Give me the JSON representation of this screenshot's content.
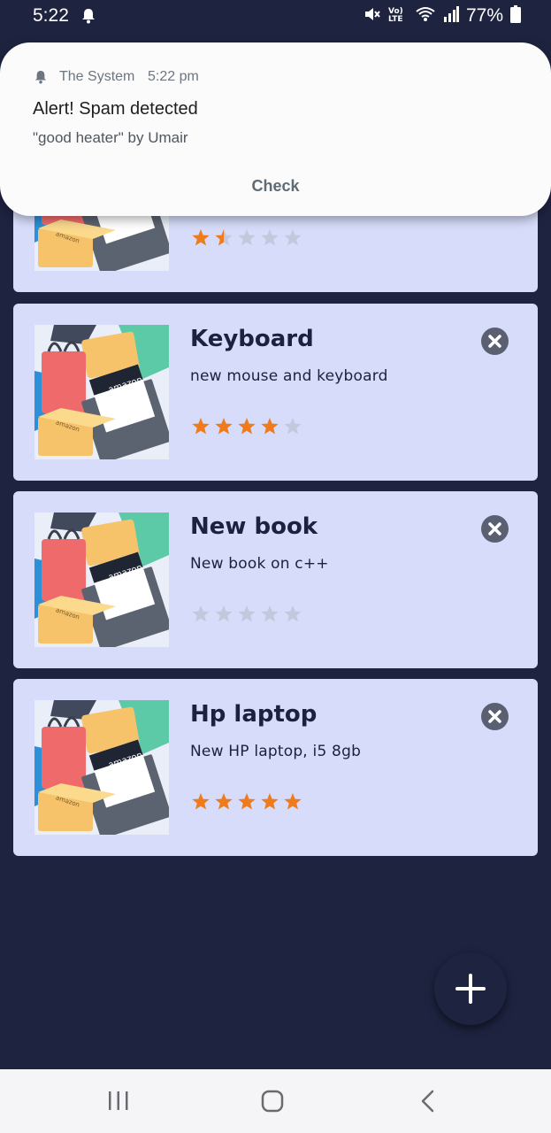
{
  "status_bar": {
    "time": "5:22",
    "network": "Vo) LTE",
    "battery": "77%"
  },
  "notification": {
    "app_name": "The System",
    "time": "5:22 pm",
    "title": "Alert! Spam detected",
    "text": "\"good heater\" by Umair",
    "action_label": "Check"
  },
  "items": [
    {
      "title": "",
      "description": "",
      "rating": 1.5
    },
    {
      "title": "Keyboard",
      "description": "new mouse and keyboard",
      "rating": 4
    },
    {
      "title": "New book",
      "description": "New book on c++",
      "rating": 0
    },
    {
      "title": "Hp laptop",
      "description": "New HP laptop, i5 8gb",
      "rating": 5
    }
  ],
  "image_brand_text": "amazon",
  "colors": {
    "background": "#1e2340",
    "card": "#d6dcfa",
    "star_filled": "#f07b1d",
    "star_empty": "#c3c8dc",
    "title_text": "#1c2140"
  },
  "icons": {
    "fab": "plus-icon",
    "close": "close-icon",
    "nav": [
      "recent-apps-icon",
      "home-icon",
      "back-icon"
    ]
  }
}
